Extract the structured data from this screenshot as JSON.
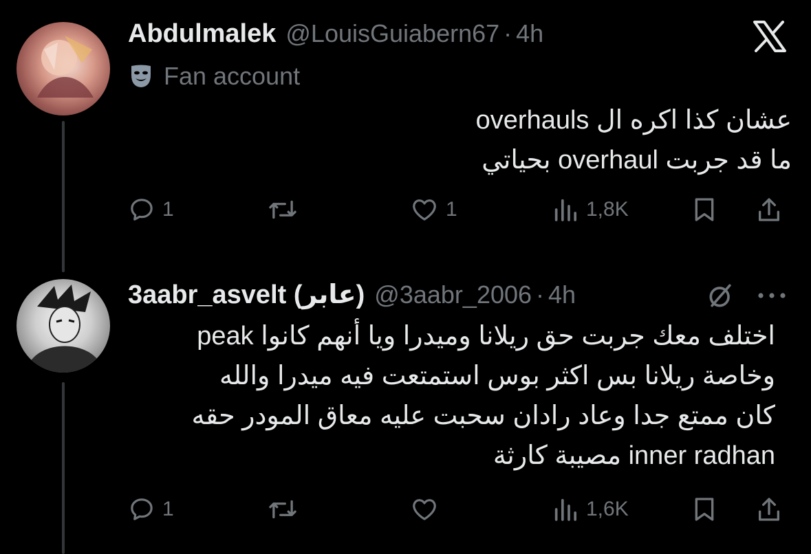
{
  "tweets": [
    {
      "display_name": "Abdulmalek",
      "handle": "@LouisGuiabern67",
      "separator": "·",
      "time": "4h",
      "badge_label": "Fan account",
      "badge_icon": "theater-mask-icon",
      "text_lines": [
        "عشان كذا اكره ال overhauls",
        "ما قد جربت overhaul بحياتي"
      ],
      "replies": "1",
      "retweets": "",
      "likes": "1",
      "views": "1,8K"
    },
    {
      "display_name": "3aabr_asvelt (عابر)",
      "handle": "@3aabr_2006",
      "separator": "·",
      "time": "4h",
      "text_lines": [
        "اختلف معك جربت حق ريلانا وميدرا ويا أنهم كانوا peak",
        "وخاصة ريلانا بس اكثر بوس استمتعت فيه ميدرا والله",
        "كان ممتع جدا وعاد رادان سحبت عليه معاق المودر حقه",
        "inner radhan مصيبة كارثة"
      ],
      "replies": "1",
      "retweets": "",
      "likes": "",
      "views": "1,6K"
    }
  ],
  "colors": {
    "background": "#000000",
    "text": "#e7e9ea",
    "muted": "#71767b",
    "badge": "#8b98a5",
    "thread": "#333639"
  }
}
